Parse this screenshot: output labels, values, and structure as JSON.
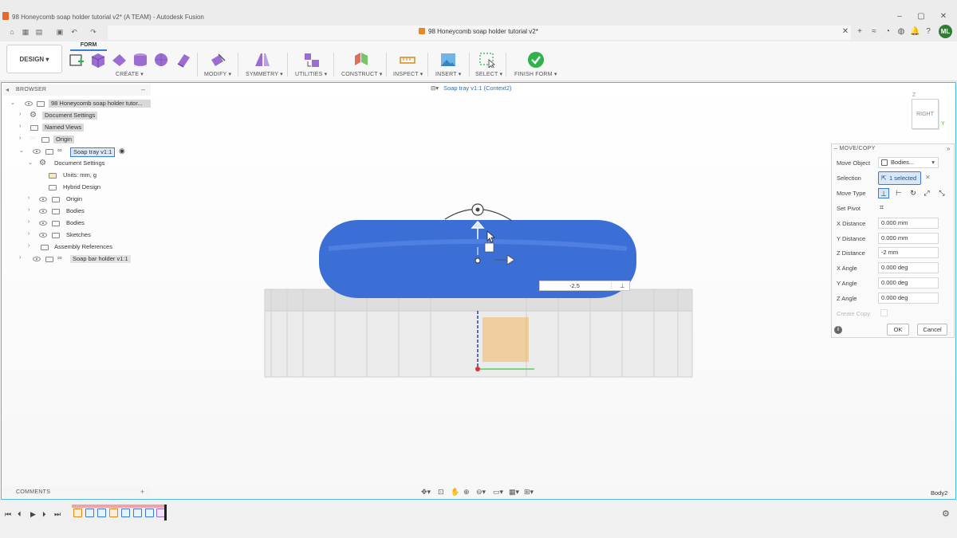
{
  "window": {
    "title": "98 Honeycomb soap holder tutorial v2* (A TEAM) - Autodesk Fusion",
    "controls": [
      "–",
      "▢",
      "✕"
    ]
  },
  "document_tab": {
    "label": "98 Honeycomb soap holder tutorial v2*",
    "close": "✕"
  },
  "user": {
    "initials": "ML",
    "avatar_color": "#2e7d32"
  },
  "toolbar": {
    "workspace": "DESIGN ▾",
    "active_tab": "FORM",
    "groups": [
      {
        "label": "CREATE ▾"
      },
      {
        "label": "MODIFY ▾"
      },
      {
        "label": "SYMMETRY ▾"
      },
      {
        "label": "UTILITIES ▾"
      },
      {
        "label": "CONSTRUCT ▾"
      },
      {
        "label": "INSPECT ▾"
      },
      {
        "label": "INSERT ▾"
      },
      {
        "label": "SELECT ▾"
      },
      {
        "label": "FINISH FORM ▾"
      }
    ],
    "accent_color": "#3a7bd5",
    "finish_color": "#2db34a"
  },
  "browser": {
    "header": "BROWSER",
    "items": [
      {
        "label": "98 Honeycomb soap holder tutor..."
      },
      {
        "label": "Document Settings"
      },
      {
        "label": "Named Views"
      },
      {
        "label": "Origin"
      },
      {
        "label": "Soap tray v1:1"
      },
      {
        "label": "Document Settings"
      },
      {
        "label": "Units: mm, g"
      },
      {
        "label": "Hybrid Design"
      },
      {
        "label": "Origin"
      },
      {
        "label": "Bodies"
      },
      {
        "label": "Bodies"
      },
      {
        "label": "Sketches"
      },
      {
        "label": "Assembly References"
      },
      {
        "label": "Soap bar holder v1:1"
      }
    ]
  },
  "context_label": "Soap tray v1:1 (Context2)",
  "viewcube": {
    "face": "RIGHT",
    "z_axis": "Z",
    "y_axis": "Y"
  },
  "manipulator": {
    "distance_input": "-2.5"
  },
  "dialog": {
    "title": "MOVE/COPY",
    "move_object_label": "Move Object",
    "move_object_value": "Bodies...",
    "selection_label": "Selection",
    "selection_value": "1 selected",
    "move_type_label": "Move Type",
    "set_pivot_label": "Set Pivot",
    "fields": [
      {
        "label": "X Distance",
        "value": "0.000 mm"
      },
      {
        "label": "Y Distance",
        "value": "0.000 mm"
      },
      {
        "label": "Z Distance",
        "value": "-2 mm"
      },
      {
        "label": "X Angle",
        "value": "0.000 deg"
      },
      {
        "label": "Y Angle",
        "value": "0.000 deg"
      },
      {
        "label": "Z Angle",
        "value": "0.000 deg"
      }
    ],
    "create_copy_label": "Create Copy",
    "create_copy_checked": false,
    "ok_label": "OK",
    "cancel_label": "Cancel"
  },
  "comments": {
    "label": "COMMENTS",
    "add": "+"
  },
  "status": {
    "body_label": "Body2"
  },
  "colors": {
    "soap_body": "#3b6fd6",
    "viewport_border": "#4fb6e6",
    "x_axis": "#d33",
    "y_axis": "#3c3",
    "z_axis": "#2b3f9e"
  }
}
